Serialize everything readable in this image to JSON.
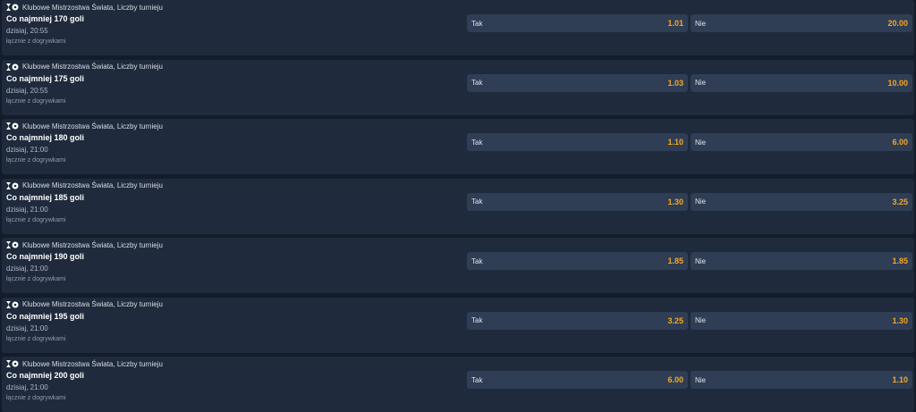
{
  "colors": {
    "background": "#141c2b",
    "card": "#1f2a3c",
    "odd_button": "#2f3d55",
    "odd_value": "#f5a623"
  },
  "icons": {
    "competition": "soccer-ball-icon"
  },
  "markets": [
    {
      "competition": "Klubowe Mistrzostwa Świata, Liczby turnieju",
      "title": "Co najmniej 170 goli",
      "time": "dzisiaj, 20:55",
      "note": "łącznie z dogrywkami",
      "yes_label": "Tak",
      "yes_odds": "1.01",
      "no_label": "Nie",
      "no_odds": "20.00"
    },
    {
      "competition": "Klubowe Mistrzostwa Świata, Liczby turnieju",
      "title": "Co najmniej 175 goli",
      "time": "dzisiaj, 20:55",
      "note": "łącznie z dogrywkami",
      "yes_label": "Tak",
      "yes_odds": "1.03",
      "no_label": "Nie",
      "no_odds": "10.00"
    },
    {
      "competition": "Klubowe Mistrzostwa Świata, Liczby turnieju",
      "title": "Co najmniej 180 goli",
      "time": "dzisiaj, 21:00",
      "note": "łącznie z dogrywkami",
      "yes_label": "Tak",
      "yes_odds": "1.10",
      "no_label": "Nie",
      "no_odds": "6.00"
    },
    {
      "competition": "Klubowe Mistrzostwa Świata, Liczby turnieju",
      "title": "Co najmniej 185 goli",
      "time": "dzisiaj, 21:00",
      "note": "łącznie z dogrywkami",
      "yes_label": "Tak",
      "yes_odds": "1.30",
      "no_label": "Nie",
      "no_odds": "3.25"
    },
    {
      "competition": "Klubowe Mistrzostwa Świata, Liczby turnieju",
      "title": "Co najmniej 190 goli",
      "time": "dzisiaj, 21:00",
      "note": "łącznie z dogrywkami",
      "yes_label": "Tak",
      "yes_odds": "1.85",
      "no_label": "Nie",
      "no_odds": "1.85"
    },
    {
      "competition": "Klubowe Mistrzostwa Świata, Liczby turnieju",
      "title": "Co najmniej 195 goli",
      "time": "dzisiaj, 21:00",
      "note": "łącznie z dogrywkami",
      "yes_label": "Tak",
      "yes_odds": "3.25",
      "no_label": "Nie",
      "no_odds": "1.30"
    },
    {
      "competition": "Klubowe Mistrzostwa Świata, Liczby turnieju",
      "title": "Co najmniej 200 goli",
      "time": "dzisiaj, 21:00",
      "note": "łącznie z dogrywkami",
      "yes_label": "Tak",
      "yes_odds": "6.00",
      "no_label": "Nie",
      "no_odds": "1.10"
    }
  ]
}
